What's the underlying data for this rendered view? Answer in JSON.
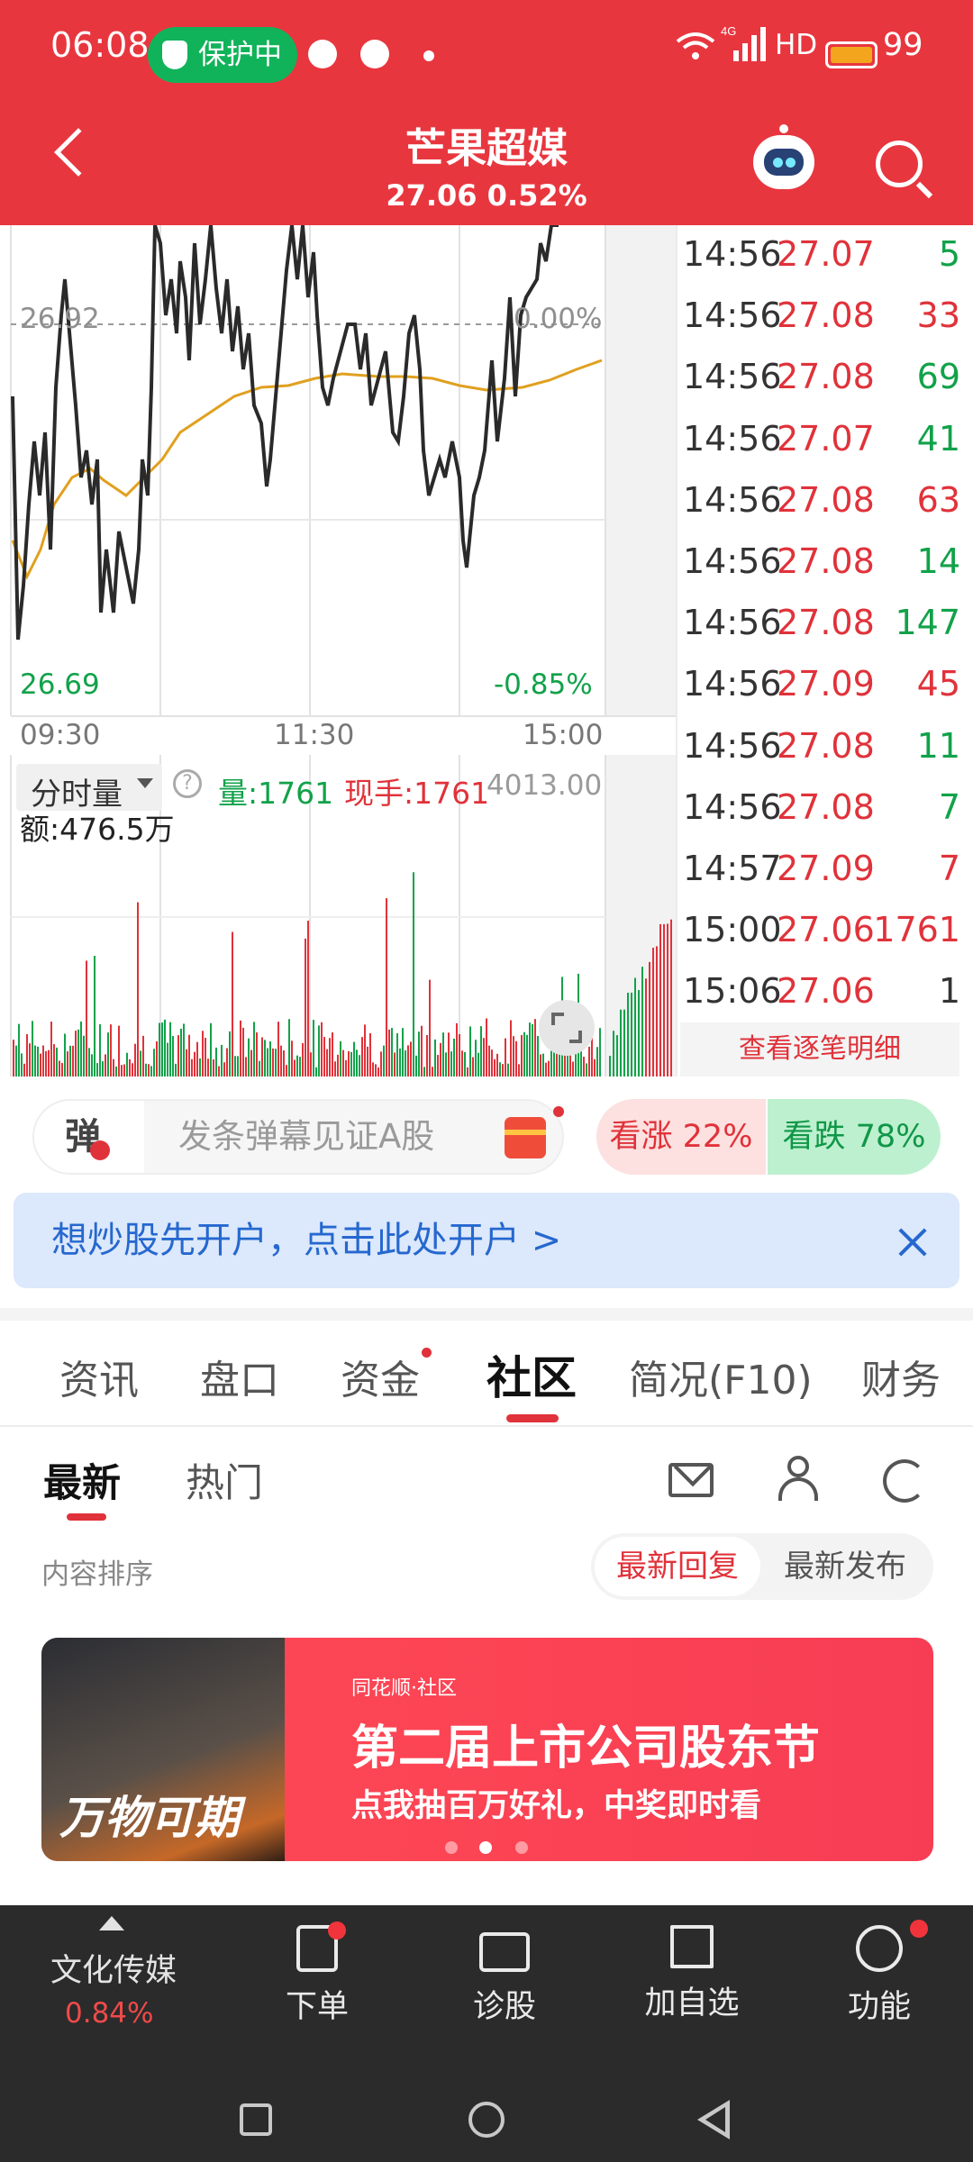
{
  "status_bar": {
    "time": "06:08",
    "protect_badge": "保护中",
    "network": "4G",
    "hd": "HD",
    "battery": "99"
  },
  "header": {
    "stock_name": "芒果超媒",
    "price_line": "27.06 0.52%"
  },
  "chart": {
    "ref_price_label": "26.92",
    "ref_pct_label": "0.00%",
    "low_price_label": "26.69",
    "low_pct_label": "-0.85%",
    "time_labels": [
      "09:30",
      "11:30",
      "15:00"
    ],
    "volume_mode": "分时量",
    "volume_label": "量:1761",
    "current_hand_label": "现手:1761",
    "volume_max": "4013.00",
    "amount_label": "额:476.5万",
    "colors": {
      "price_line": "#333333",
      "avg_line": "#e0a020",
      "up": "#e0323a",
      "down": "#12a24a"
    }
  },
  "trades": [
    {
      "time": "14:56",
      "price": "27.07",
      "volume": "5",
      "dir": "green"
    },
    {
      "time": "14:56",
      "price": "27.08",
      "volume": "33",
      "dir": "red"
    },
    {
      "time": "14:56",
      "price": "27.08",
      "volume": "69",
      "dir": "green"
    },
    {
      "time": "14:56",
      "price": "27.07",
      "volume": "41",
      "dir": "green"
    },
    {
      "time": "14:56",
      "price": "27.08",
      "volume": "63",
      "dir": "red"
    },
    {
      "time": "14:56",
      "price": "27.08",
      "volume": "14",
      "dir": "green"
    },
    {
      "time": "14:56",
      "price": "27.08",
      "volume": "147",
      "dir": "green"
    },
    {
      "time": "14:56",
      "price": "27.09",
      "volume": "45",
      "dir": "red"
    },
    {
      "time": "14:56",
      "price": "27.08",
      "volume": "11",
      "dir": "green"
    },
    {
      "time": "14:56",
      "price": "27.08",
      "volume": "7",
      "dir": "green"
    },
    {
      "time": "14:57",
      "price": "27.09",
      "volume": "7",
      "dir": "red"
    },
    {
      "time": "15:00",
      "price": "27.06",
      "volume": "1761",
      "dir": "red"
    },
    {
      "time": "15:06",
      "price": "27.06",
      "volume": "1",
      "dir": "gray"
    }
  ],
  "trades_link": "查看逐笔明细",
  "danmu": {
    "badge": "弹",
    "placeholder": "发条弹幕见证A股",
    "rise": "看涨 22%",
    "fall": "看跌 78%"
  },
  "open_account_banner": "想炒股先开户，点击此处开户 >",
  "tabs": [
    "资讯",
    "盘口",
    "资金",
    "社区",
    "简况(F10)",
    "财务"
  ],
  "active_tab": "社区",
  "sub_tabs": [
    "最新",
    "热门"
  ],
  "sort": {
    "label": "内容排序",
    "option_a": "最新回复",
    "option_b": "最新发布"
  },
  "promo": {
    "photo_text": "万物可期",
    "brand": "同花顺·社区",
    "title": "第二届上市公司股东节",
    "subtitle": "点我抽百万好礼，中奖即时看"
  },
  "bottom": {
    "sector_name": "文化传媒",
    "sector_change": "0.84%",
    "nav": [
      "下单",
      "诊股",
      "加自选",
      "功能"
    ]
  }
}
